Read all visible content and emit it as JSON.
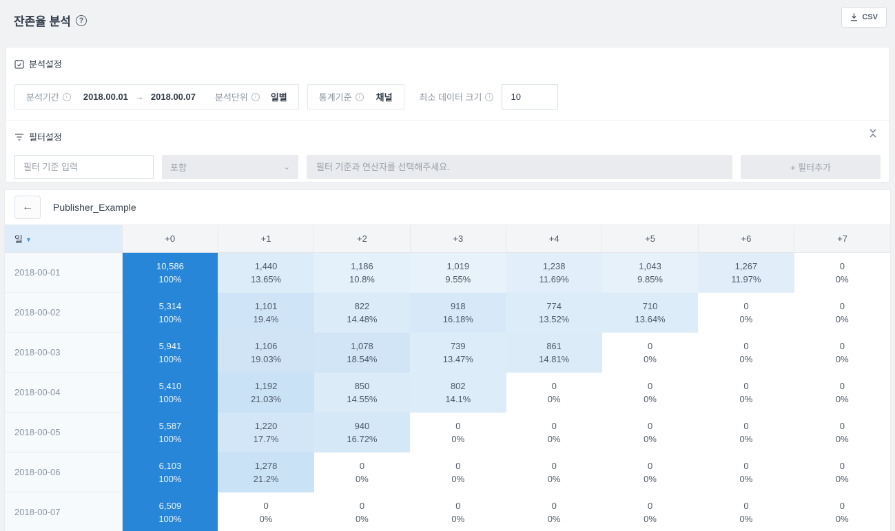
{
  "page": {
    "title": "잔존율 분석"
  },
  "toolbar": {
    "csv_label": "CSV"
  },
  "icons": {
    "help": "?",
    "info": "i",
    "period_arrow": "→",
    "select_chevron": "⌄",
    "back": "←",
    "sort": "▼"
  },
  "settings": {
    "section_title": "분석설정",
    "period_label": "분석기간",
    "period_start": "2018.00.01",
    "period_end": "2018.00.07",
    "unit_label": "분석단위",
    "unit_value": "일별",
    "stat_label": "통계기준",
    "stat_value": "채널",
    "min_size_label": "최소 데이터 크기",
    "min_size_value": "10"
  },
  "filter": {
    "section_title": "필터설정",
    "criteria_placeholder": "필터 기준 입력",
    "operator_value": "포함",
    "value_placeholder": "필터 기준과 연산자를 선택해주세요.",
    "add_button_label": "+ 필터추가"
  },
  "table": {
    "group_title": "Publisher_Example",
    "first_col_header": "일",
    "col_headers": [
      "+0",
      "+1",
      "+2",
      "+3",
      "+4",
      "+5",
      "+6",
      "+7"
    ],
    "rows": [
      {
        "date": "2018-00-01",
        "cells": [
          {
            "count": "10,586",
            "pct": "100%",
            "p": 100
          },
          {
            "count": "1,440",
            "pct": "13.65%",
            "p": 13.65
          },
          {
            "count": "1,186",
            "pct": "10.8%",
            "p": 10.8
          },
          {
            "count": "1,019",
            "pct": "9.55%",
            "p": 9.55
          },
          {
            "count": "1,238",
            "pct": "11.69%",
            "p": 11.69
          },
          {
            "count": "1,043",
            "pct": "9.85%",
            "p": 9.85
          },
          {
            "count": "1,267",
            "pct": "11.97%",
            "p": 11.97
          },
          {
            "count": "0",
            "pct": "0%",
            "p": 0
          }
        ]
      },
      {
        "date": "2018-00-02",
        "cells": [
          {
            "count": "5,314",
            "pct": "100%",
            "p": 100
          },
          {
            "count": "1,101",
            "pct": "19.4%",
            "p": 19.4
          },
          {
            "count": "822",
            "pct": "14.48%",
            "p": 14.48
          },
          {
            "count": "918",
            "pct": "16.18%",
            "p": 16.18
          },
          {
            "count": "774",
            "pct": "13.52%",
            "p": 13.52
          },
          {
            "count": "710",
            "pct": "13.64%",
            "p": 13.64
          },
          {
            "count": "0",
            "pct": "0%",
            "p": 0
          },
          {
            "count": "0",
            "pct": "0%",
            "p": 0
          }
        ]
      },
      {
        "date": "2018-00-03",
        "cells": [
          {
            "count": "5,941",
            "pct": "100%",
            "p": 100
          },
          {
            "count": "1,106",
            "pct": "19.03%",
            "p": 19.03
          },
          {
            "count": "1,078",
            "pct": "18.54%",
            "p": 18.54
          },
          {
            "count": "739",
            "pct": "13.47%",
            "p": 13.47
          },
          {
            "count": "861",
            "pct": "14.81%",
            "p": 14.81
          },
          {
            "count": "0",
            "pct": "0%",
            "p": 0
          },
          {
            "count": "0",
            "pct": "0%",
            "p": 0
          },
          {
            "count": "0",
            "pct": "0%",
            "p": 0
          }
        ]
      },
      {
        "date": "2018-00-04",
        "cells": [
          {
            "count": "5,410",
            "pct": "100%",
            "p": 100
          },
          {
            "count": "1,192",
            "pct": "21.03%",
            "p": 21.03
          },
          {
            "count": "850",
            "pct": "14.55%",
            "p": 14.55
          },
          {
            "count": "802",
            "pct": "14.1%",
            "p": 14.1
          },
          {
            "count": "0",
            "pct": "0%",
            "p": 0
          },
          {
            "count": "0",
            "pct": "0%",
            "p": 0
          },
          {
            "count": "0",
            "pct": "0%",
            "p": 0
          },
          {
            "count": "0",
            "pct": "0%",
            "p": 0
          }
        ]
      },
      {
        "date": "2018-00-05",
        "cells": [
          {
            "count": "5,587",
            "pct": "100%",
            "p": 100
          },
          {
            "count": "1,220",
            "pct": "17.7%",
            "p": 17.7
          },
          {
            "count": "940",
            "pct": "16.72%",
            "p": 16.72
          },
          {
            "count": "0",
            "pct": "0%",
            "p": 0
          },
          {
            "count": "0",
            "pct": "0%",
            "p": 0
          },
          {
            "count": "0",
            "pct": "0%",
            "p": 0
          },
          {
            "count": "0",
            "pct": "0%",
            "p": 0
          },
          {
            "count": "0",
            "pct": "0%",
            "p": 0
          }
        ]
      },
      {
        "date": "2018-00-06",
        "cells": [
          {
            "count": "6,103",
            "pct": "100%",
            "p": 100
          },
          {
            "count": "1,278",
            "pct": "21.2%",
            "p": 21.2
          },
          {
            "count": "0",
            "pct": "0%",
            "p": 0
          },
          {
            "count": "0",
            "pct": "0%",
            "p": 0
          },
          {
            "count": "0",
            "pct": "0%",
            "p": 0
          },
          {
            "count": "0",
            "pct": "0%",
            "p": 0
          },
          {
            "count": "0",
            "pct": "0%",
            "p": 0
          },
          {
            "count": "0",
            "pct": "0%",
            "p": 0
          }
        ]
      },
      {
        "date": "2018-00-07",
        "cells": [
          {
            "count": "6,509",
            "pct": "100%",
            "p": 100
          },
          {
            "count": "0",
            "pct": "0%",
            "p": 0
          },
          {
            "count": "0",
            "pct": "0%",
            "p": 0
          },
          {
            "count": "0",
            "pct": "0%",
            "p": 0
          },
          {
            "count": "0",
            "pct": "0%",
            "p": 0
          },
          {
            "count": "0",
            "pct": "0%",
            "p": 0
          },
          {
            "count": "0",
            "pct": "0%",
            "p": 0
          },
          {
            "count": "0",
            "pct": "0%",
            "p": 0
          }
        ]
      }
    ]
  },
  "colors": {
    "accent_blue": "#2786d7",
    "cell_base_rgb": "39,134,215",
    "page_bg": "#f0f2f4",
    "day_header_bg": "#deedf9"
  }
}
